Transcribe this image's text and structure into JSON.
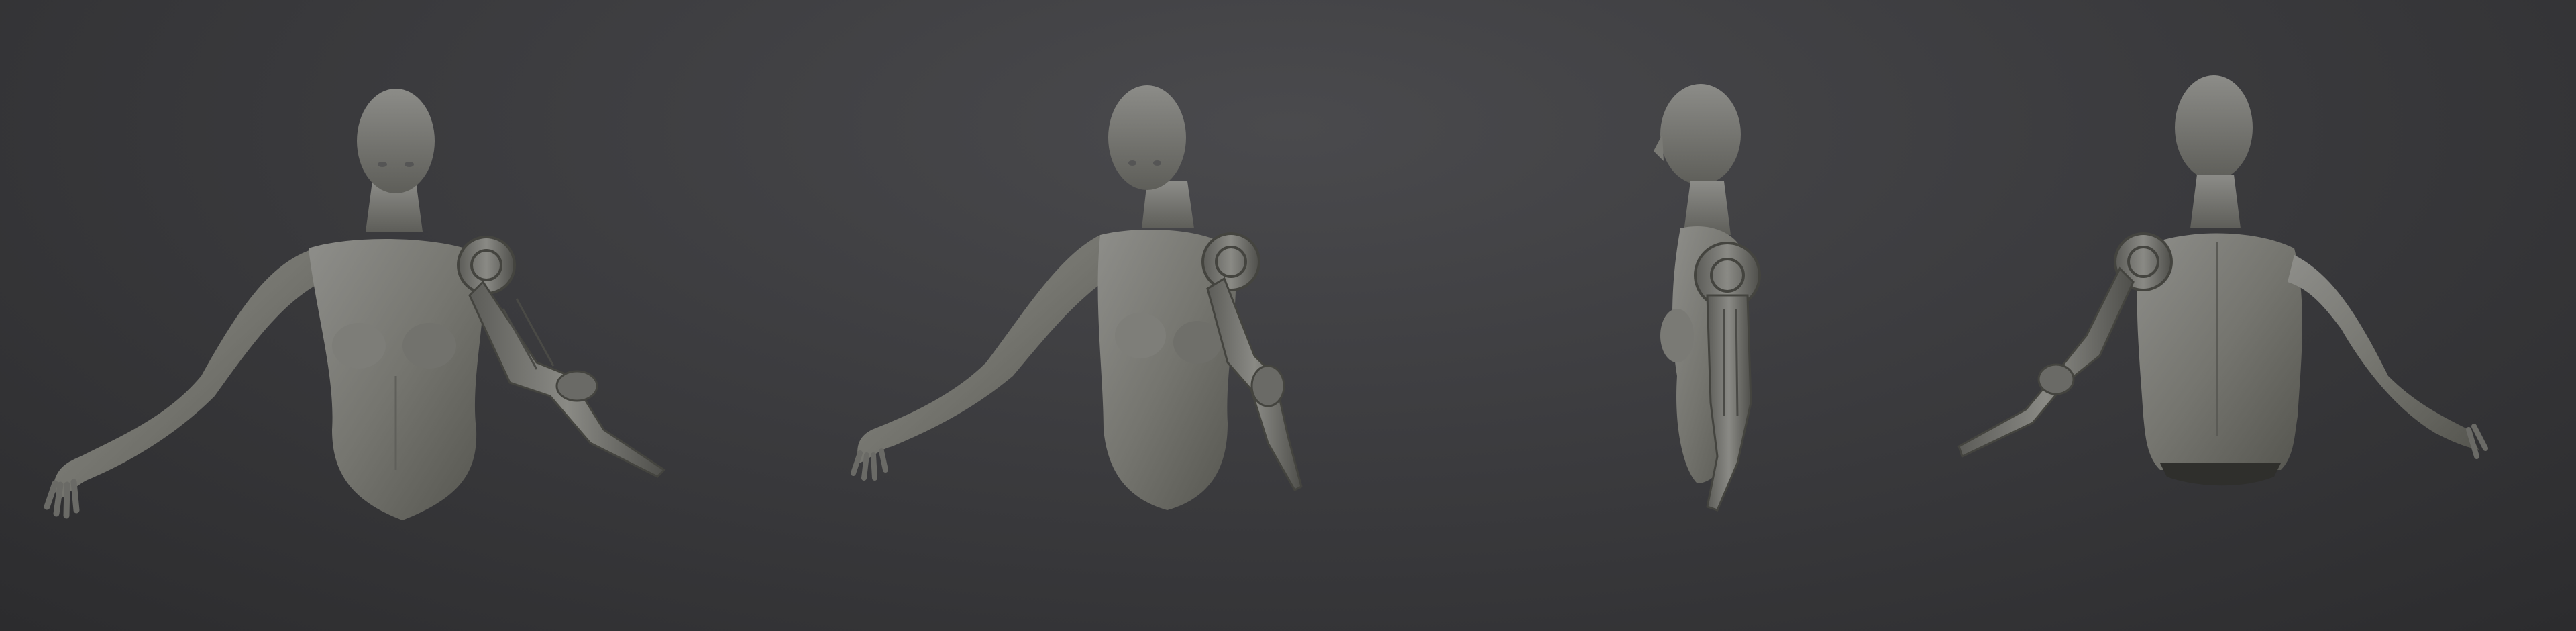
{
  "scene": {
    "background_top": "#4a4a4d",
    "background_bottom": "#2c2c2e",
    "material_light": "#8a8a86",
    "material_mid": "#6f6f6b",
    "material_dark": "#4e4e4b",
    "views": [
      {
        "id": "front",
        "icon": "figure-front-view"
      },
      {
        "id": "three-quarter",
        "icon": "figure-three-quarter-view"
      },
      {
        "id": "side",
        "icon": "figure-side-view"
      },
      {
        "id": "back",
        "icon": "figure-back-view"
      }
    ]
  }
}
